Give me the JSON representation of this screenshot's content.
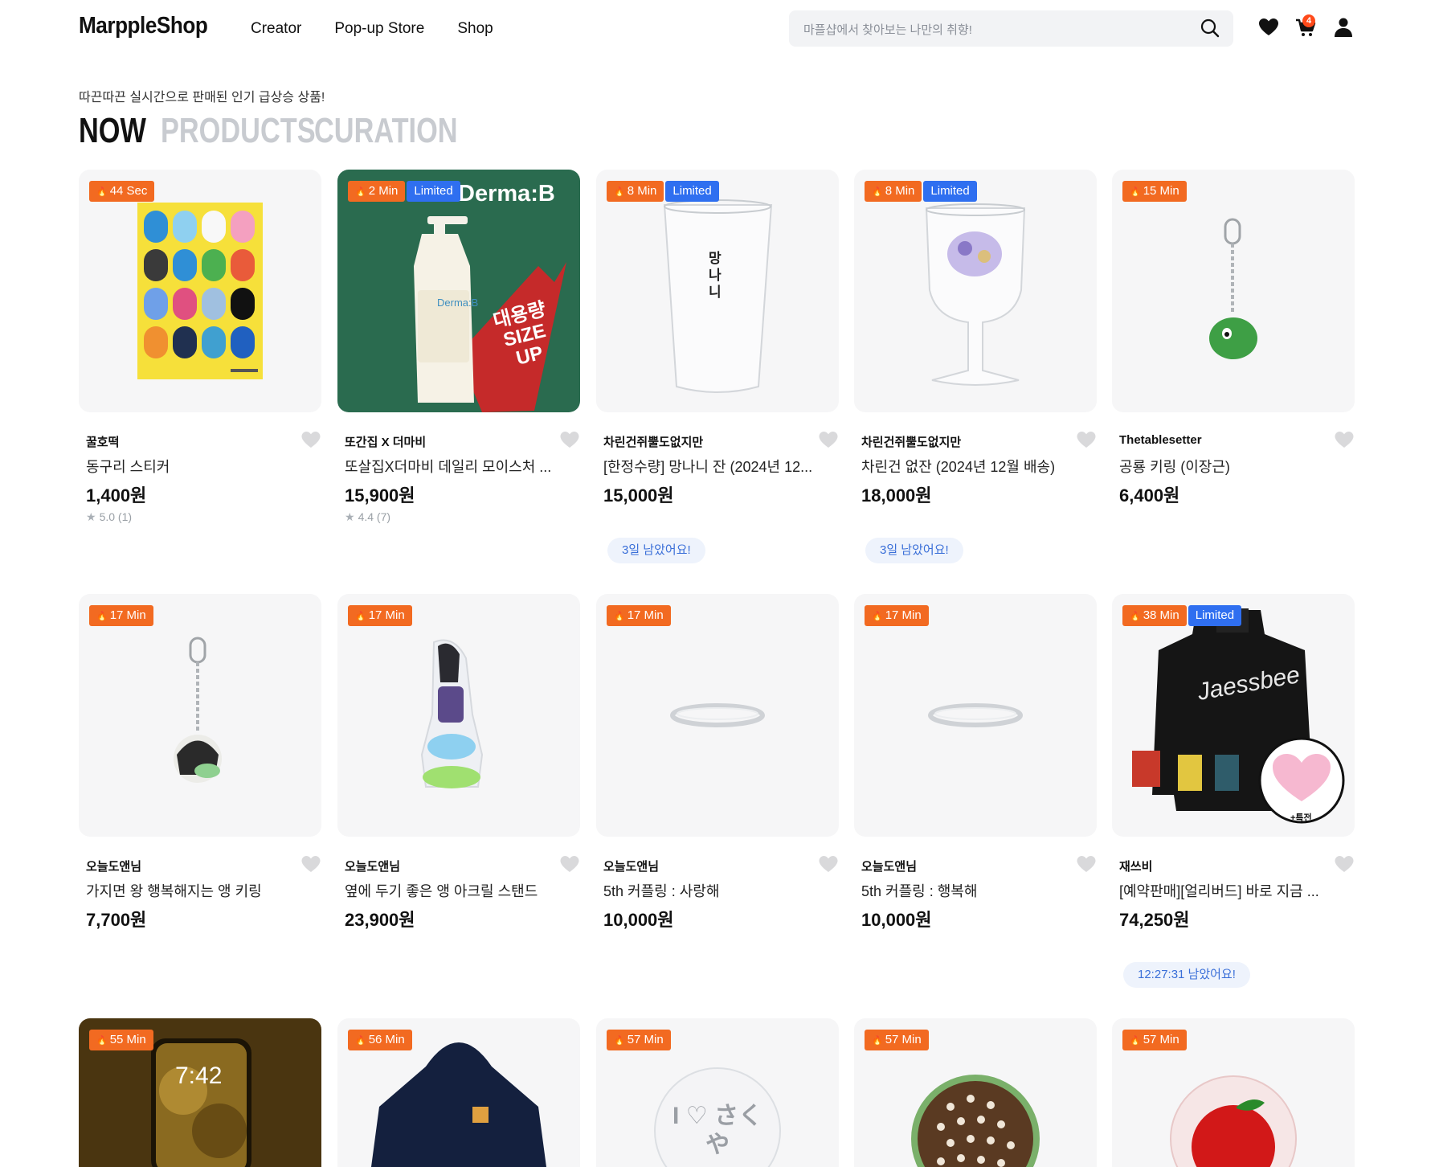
{
  "header": {
    "logo": "MarppleShop",
    "nav": [
      "Creator",
      "Pop-up Store",
      "Shop"
    ],
    "search_placeholder": "마플샵에서 찾아보는 나만의 취향!",
    "cart_count": "4",
    "icons": [
      "search-icon",
      "heart-icon",
      "cart-icon",
      "user-icon"
    ]
  },
  "section": {
    "subtitle": "따끈따끈 실시간으로 판매된 인기 급상승 상품!",
    "tabs": [
      "NOW",
      "PRODUCTS",
      "CURATION"
    ]
  },
  "products": [
    {
      "time": "44 Sec",
      "limited": "",
      "creator": "꿀호떡",
      "name": "동구리 스티커",
      "price": "1,400원",
      "rating": "5.0 (1)",
      "deadline": ""
    },
    {
      "time": "2 Min",
      "limited": "Limited",
      "creator": "또간집 X 더마비",
      "name": "또살집X더마비 데일리 모이스처 ...",
      "price": "15,900원",
      "rating": "4.4 (7)",
      "deadline": ""
    },
    {
      "time": "8 Min",
      "limited": "Limited",
      "creator": "차린건쥐뿔도없지만",
      "name": "[한정수량] 망나니 잔 (2024년 12...",
      "price": "15,000원",
      "rating": "",
      "deadline": "3일 남았어요!"
    },
    {
      "time": "8 Min",
      "limited": "Limited",
      "creator": "차린건쥐뿔도없지만",
      "name": "차린건 없잔 (2024년 12월 배송)",
      "price": "18,000원",
      "rating": "",
      "deadline": "3일 남았어요!"
    },
    {
      "time": "15 Min",
      "limited": "",
      "creator": "Thetablesetter",
      "name": "공룡 키링 (이장근)",
      "price": "6,400원",
      "rating": "",
      "deadline": ""
    },
    {
      "time": "17 Min",
      "limited": "",
      "creator": "오늘도앤님",
      "name": "가지면 왕 행복해지는 앵 키링",
      "price": "7,700원",
      "rating": "",
      "deadline": ""
    },
    {
      "time": "17 Min",
      "limited": "",
      "creator": "오늘도앤님",
      "name": "옆에 두기 좋은 앵 아크릴 스탠드",
      "price": "23,900원",
      "rating": "",
      "deadline": ""
    },
    {
      "time": "17 Min",
      "limited": "",
      "creator": "오늘도앤님",
      "name": "5th 커플링 : 사랑해",
      "price": "10,000원",
      "rating": "",
      "deadline": ""
    },
    {
      "time": "17 Min",
      "limited": "",
      "creator": "오늘도앤님",
      "name": "5th 커플링 : 행복해",
      "price": "10,000원",
      "rating": "",
      "deadline": ""
    },
    {
      "time": "38 Min",
      "limited": "Limited",
      "creator": "재쓰비",
      "name": "[예약판매][얼리버드] 바로 지금 ...",
      "price": "74,250원",
      "rating": "",
      "deadline": "12:27:31 남았어요!"
    },
    {
      "time": "55 Min",
      "limited": "",
      "creator": "",
      "name": "",
      "price": "",
      "rating": "",
      "deadline": ""
    },
    {
      "time": "56 Min",
      "limited": "",
      "creator": "",
      "name": "",
      "price": "",
      "rating": "",
      "deadline": ""
    },
    {
      "time": "57 Min",
      "limited": "",
      "creator": "",
      "name": "",
      "price": "",
      "rating": "",
      "deadline": ""
    },
    {
      "time": "57 Min",
      "limited": "",
      "creator": "",
      "name": "",
      "price": "",
      "rating": "",
      "deadline": ""
    },
    {
      "time": "57 Min",
      "limited": "",
      "creator": "",
      "name": "",
      "price": "",
      "rating": "",
      "deadline": ""
    }
  ],
  "image_text": {
    "dermab_brand": "Derma:B",
    "dermab_bottle": "Derma:B",
    "dermab_promo": "대용량 SIZE UP",
    "glass_text": "망나니",
    "sweater_text": "Jaessbee",
    "sweater_bonus": "+특전",
    "phone_time": "7:42",
    "pin_text": "I ♡ さくや"
  },
  "colors": {
    "accent_orange": "#f26a21",
    "limited_blue": "#2f6ff0",
    "deadline_bg": "#eef3fc",
    "deadline_text": "#3a6fd8"
  }
}
